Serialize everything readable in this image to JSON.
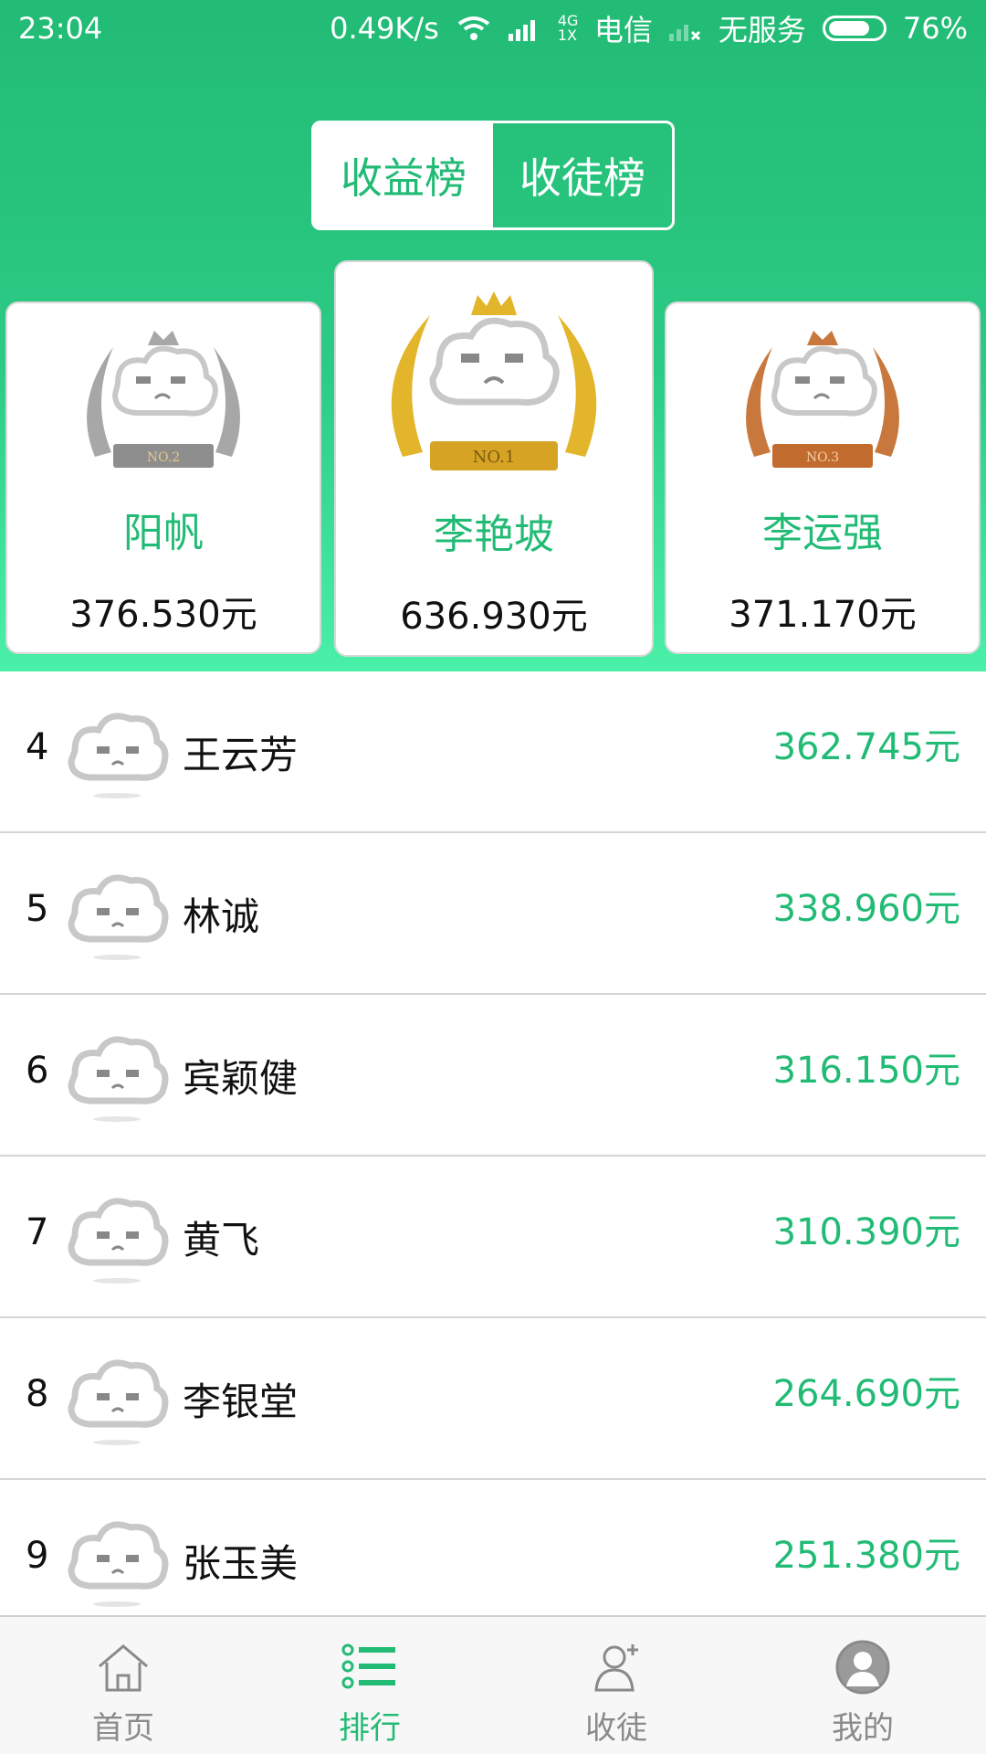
{
  "status_bar": {
    "time": "23:04",
    "speed": "0.49K/s",
    "network": "4G 1X",
    "carrier": "电信",
    "second_sim": "无服务",
    "battery": "76%"
  },
  "tabs": {
    "active": "收益榜",
    "inactive": "收徒榜"
  },
  "podium": [
    {
      "rank_badge": "NO.2",
      "name": "阳帆",
      "amount": "376.530元",
      "color": "#a7a7a7"
    },
    {
      "rank_badge": "NO.1",
      "name": "李艳坡",
      "amount": "636.930元",
      "color": "#e2b52a"
    },
    {
      "rank_badge": "NO.3",
      "name": "李运强",
      "amount": "371.170元",
      "color": "#c9783d"
    }
  ],
  "ranking": [
    {
      "rank": "4",
      "name": "王云芳",
      "amount": "362.745元"
    },
    {
      "rank": "5",
      "name": "林诚",
      "amount": "338.960元"
    },
    {
      "rank": "6",
      "name": "宾颖健",
      "amount": "316.150元"
    },
    {
      "rank": "7",
      "name": "黄飞",
      "amount": "310.390元"
    },
    {
      "rank": "8",
      "name": "李银堂",
      "amount": "264.690元"
    },
    {
      "rank": "9",
      "name": "张玉美",
      "amount": "251.380元"
    }
  ],
  "nav": [
    {
      "label": "首页",
      "icon": "home-icon"
    },
    {
      "label": "排行",
      "icon": "list-icon"
    },
    {
      "label": "收徒",
      "icon": "add-user-icon"
    },
    {
      "label": "我的",
      "icon": "profile-icon"
    }
  ],
  "colors": {
    "accent": "#22bb75",
    "header_gradient_end": "#4af0a8"
  }
}
